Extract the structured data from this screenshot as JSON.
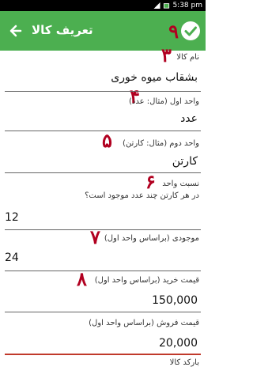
{
  "status_bar": {
    "time": "5:38 pm"
  },
  "app_bar": {
    "title": "تعریف کالا",
    "back_icon": "arrow-left-icon",
    "save_icon": "check-circle-icon"
  },
  "annotations": [
    "٩",
    "٣",
    "۴",
    "۵",
    "۶",
    "٧",
    "٨"
  ],
  "fields": [
    {
      "label": "نام کالا",
      "value": "بشقاب میوه خوری"
    },
    {
      "label": "واحد اول (مثال: عدد)",
      "value": "عدد"
    },
    {
      "label": "واحد دوم (مثال: کارتن)",
      "value": "کارتن"
    },
    {
      "label": "نسبت واحد",
      "hint": "در هر کارتن چند عدد موجود است؟",
      "value": "12"
    },
    {
      "label": "موجودی (براساس واحد اول)",
      "value": "24"
    },
    {
      "label": "قیمت خرید (براساس واحد اول)",
      "value": "150,000"
    },
    {
      "label": "قیمت فروش (براساس واحد اول)",
      "value": "20,000"
    },
    {
      "label": "بارکد کالا"
    }
  ],
  "colors": {
    "app_bar": "#4caf50",
    "annotation": "#b10020",
    "active_underline": "#c0392b"
  }
}
